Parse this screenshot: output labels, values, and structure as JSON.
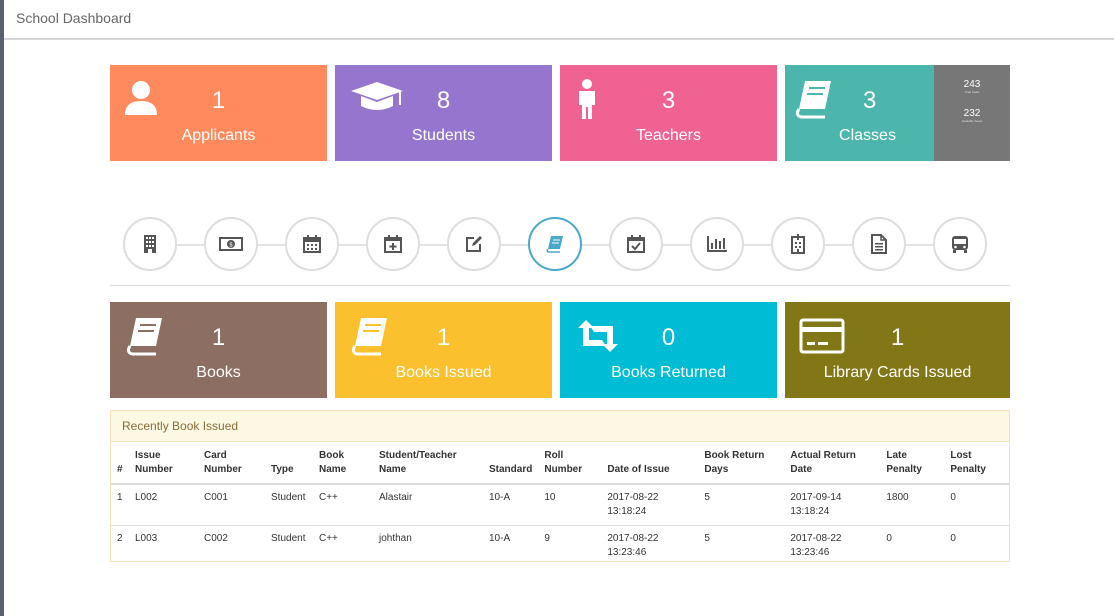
{
  "header": {
    "title": "School Dashboard"
  },
  "stats": [
    {
      "value": "1",
      "label": "Applicants",
      "icon": "user-icon",
      "color": "#fe8a5e"
    },
    {
      "value": "8",
      "label": "Students",
      "icon": "graduation-cap-icon",
      "color": "#9575cd"
    },
    {
      "value": "3",
      "label": "Teachers",
      "icon": "person-icon",
      "color": "#f06292"
    },
    {
      "value": "3",
      "label": "Classes",
      "icon": "book-icon",
      "color": "#4db6ac"
    }
  ],
  "class_seats": {
    "total": "243",
    "total_label": "Total Seats",
    "available": "232",
    "available_label": "Available Seats"
  },
  "modules": [
    {
      "icon": "building-icon"
    },
    {
      "icon": "money-icon"
    },
    {
      "icon": "calendar-icon"
    },
    {
      "icon": "calendar-plus-icon"
    },
    {
      "icon": "edit-icon"
    },
    {
      "icon": "book-icon",
      "active": true
    },
    {
      "icon": "calendar-check-icon"
    },
    {
      "icon": "bar-chart-icon"
    },
    {
      "icon": "hospital-icon"
    },
    {
      "icon": "document-icon"
    },
    {
      "icon": "bus-icon"
    }
  ],
  "library": [
    {
      "value": "1",
      "label": "Books",
      "icon": "book-icon",
      "color": "#8d6e63"
    },
    {
      "value": "1",
      "label": "Books Issued",
      "icon": "book-icon",
      "color": "#fbc02d"
    },
    {
      "value": "0",
      "label": "Books Returned",
      "icon": "retweet-icon",
      "color": "#00bcd4"
    },
    {
      "value": "1",
      "label": "Library Cards Issued",
      "icon": "credit-card-icon",
      "color": "#827717"
    }
  ],
  "recent": {
    "title": "Recently Book Issued",
    "columns": [
      "#",
      "Issue Number",
      "Card Number",
      "Type",
      "Book Name",
      "Student/Teacher Name",
      "Standard",
      "Roll Number",
      "Date of Issue",
      "Book Return Days",
      "Actual Return Date",
      "Late Penalty",
      "Lost Penalty"
    ],
    "rows": [
      [
        "1",
        "L002",
        "C001",
        "Student",
        "C++",
        "Alastair",
        "10-A",
        "10",
        "2017-08-22 13:18:24",
        "5",
        "2017-09-14 13:18:24",
        "1800",
        "0"
      ],
      [
        "2",
        "L003",
        "C002",
        "Student",
        "C++",
        "johthan",
        "10-A",
        "9",
        "2017-08-22 13:23:46",
        "5",
        "2017-08-22 13:23:46",
        "0",
        "0"
      ]
    ]
  }
}
